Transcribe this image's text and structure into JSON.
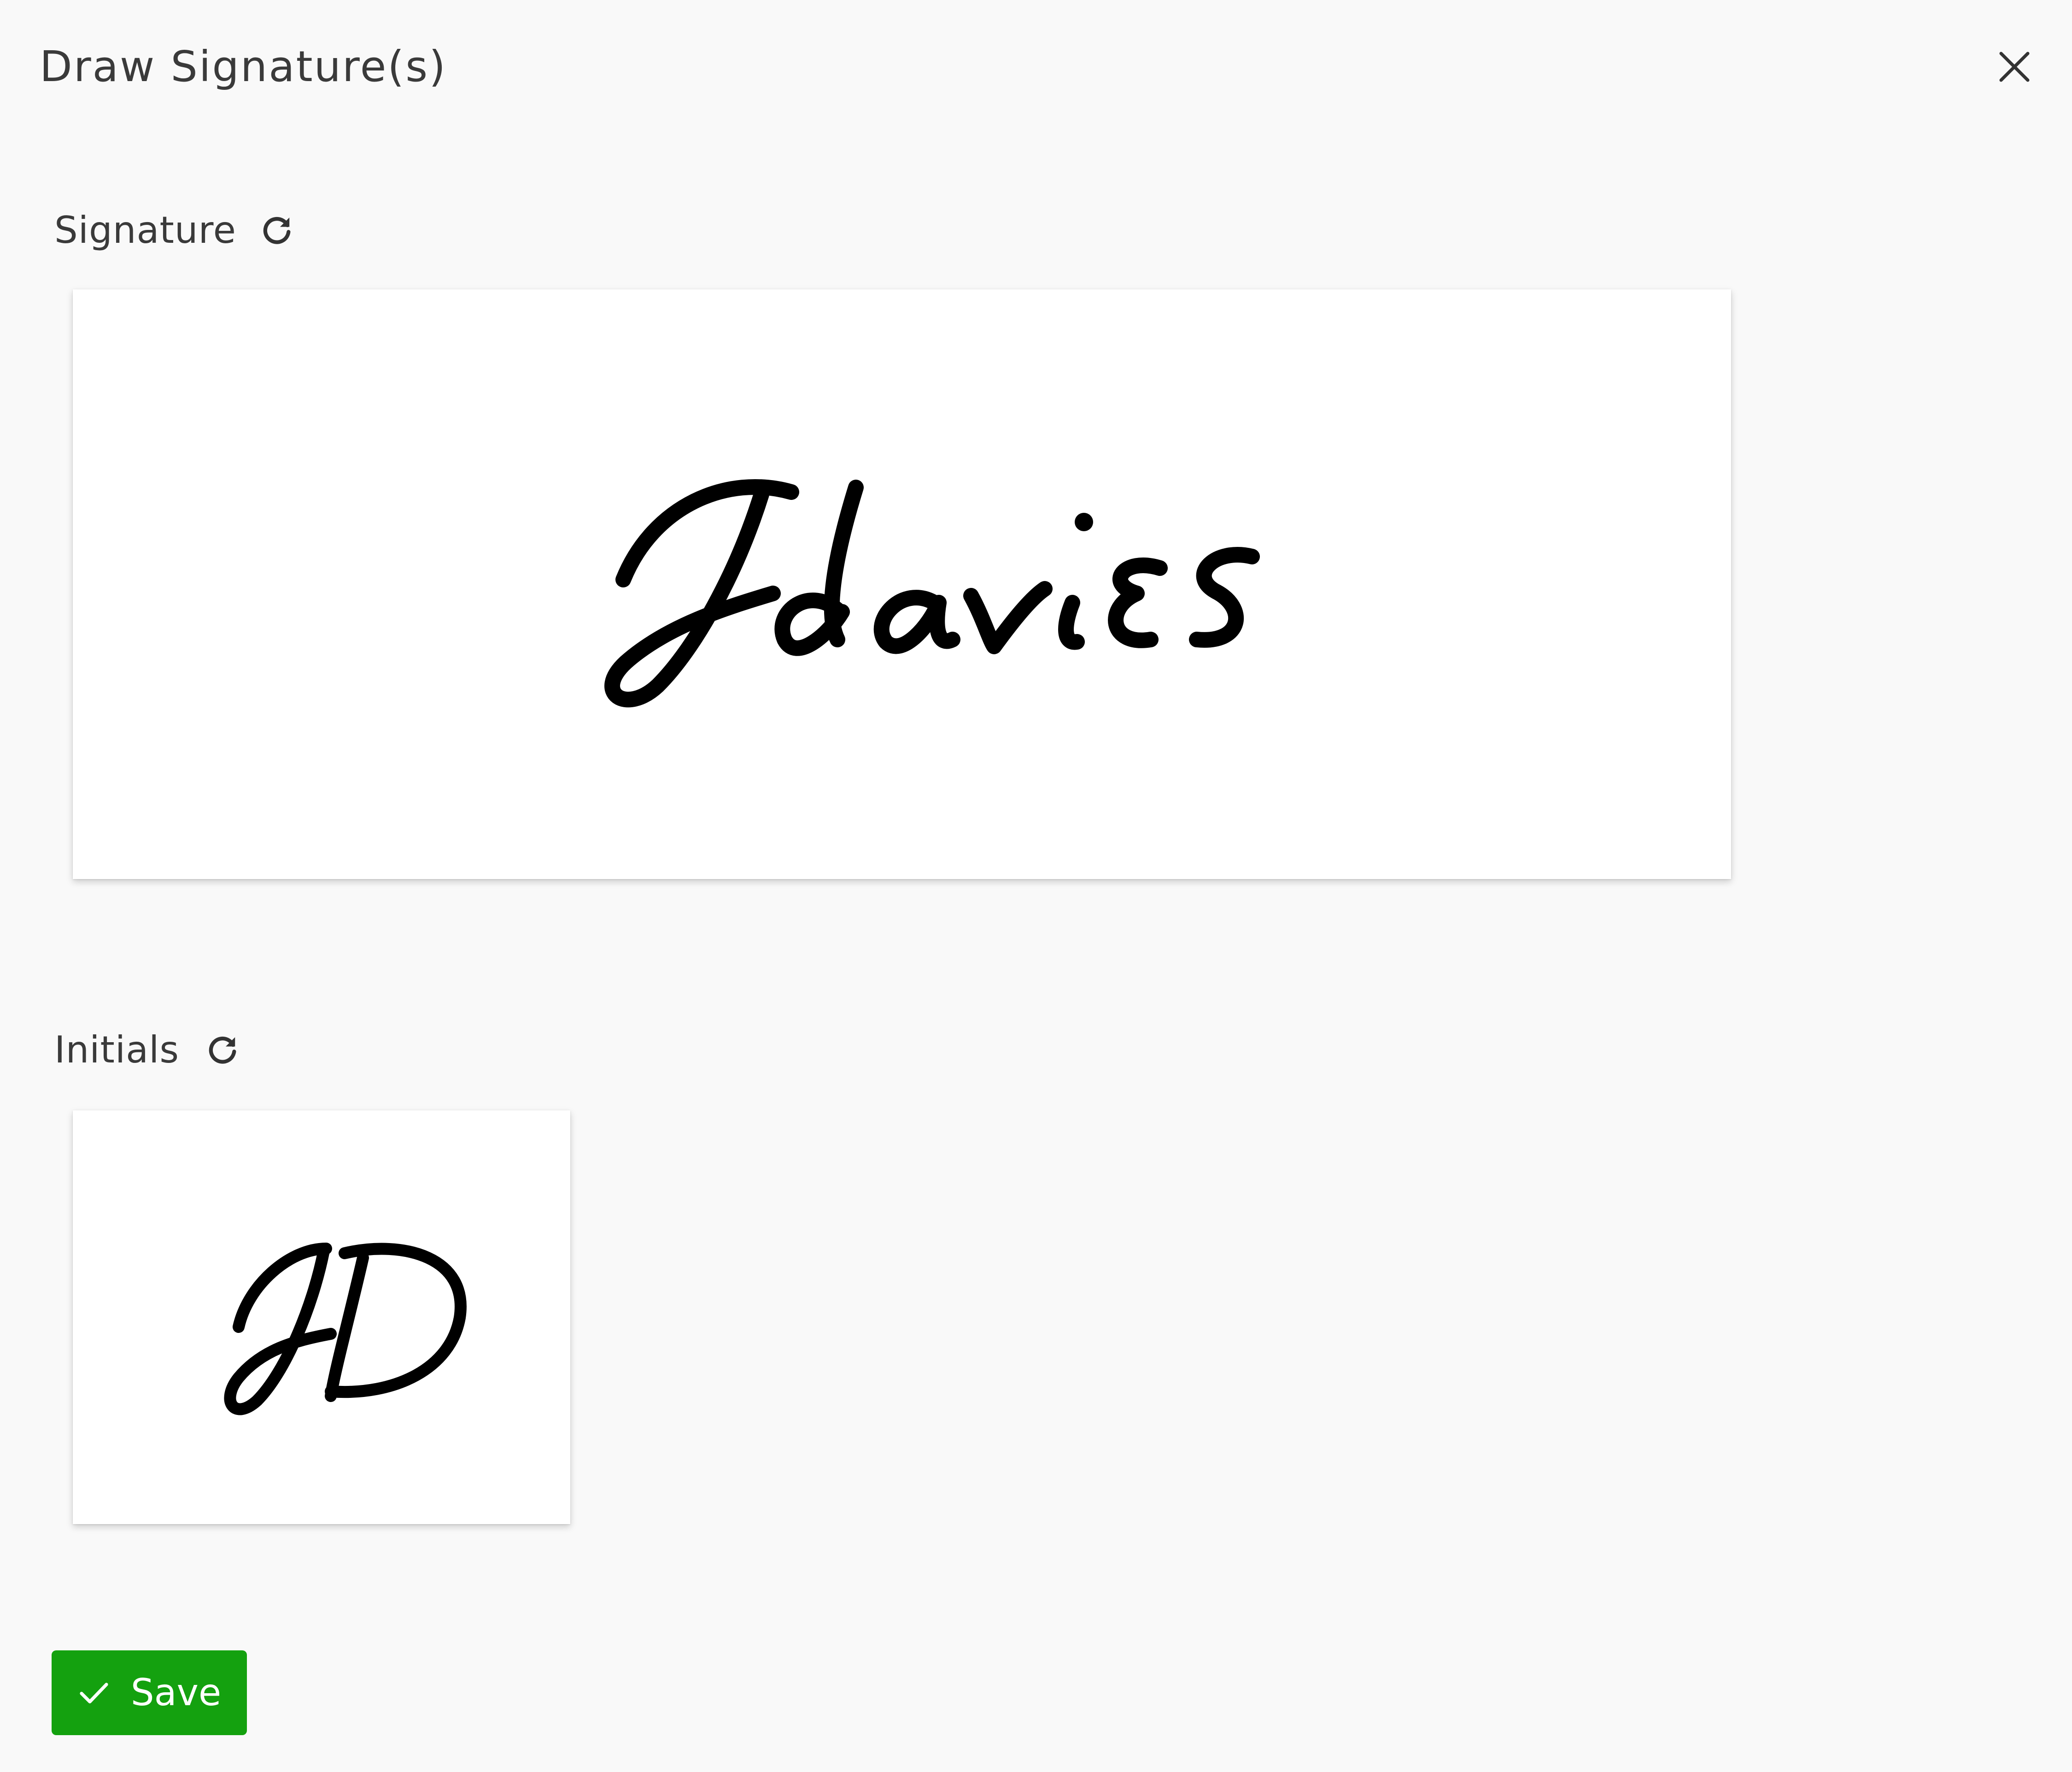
{
  "dialog": {
    "title": "Draw Signature(s)"
  },
  "signature": {
    "label": "Signature",
    "drawn_text": "Jdavies"
  },
  "initials": {
    "label": "Initials",
    "drawn_text": "JD"
  },
  "actions": {
    "save_label": "Save"
  },
  "icons": {
    "close": "close-icon",
    "reset": "refresh-icon",
    "save": "check-icon"
  },
  "colors": {
    "background": "#f9f9f9",
    "pad": "#ffffff",
    "save_button": "#14a10f",
    "text": "#333333",
    "ink": "#000000"
  }
}
